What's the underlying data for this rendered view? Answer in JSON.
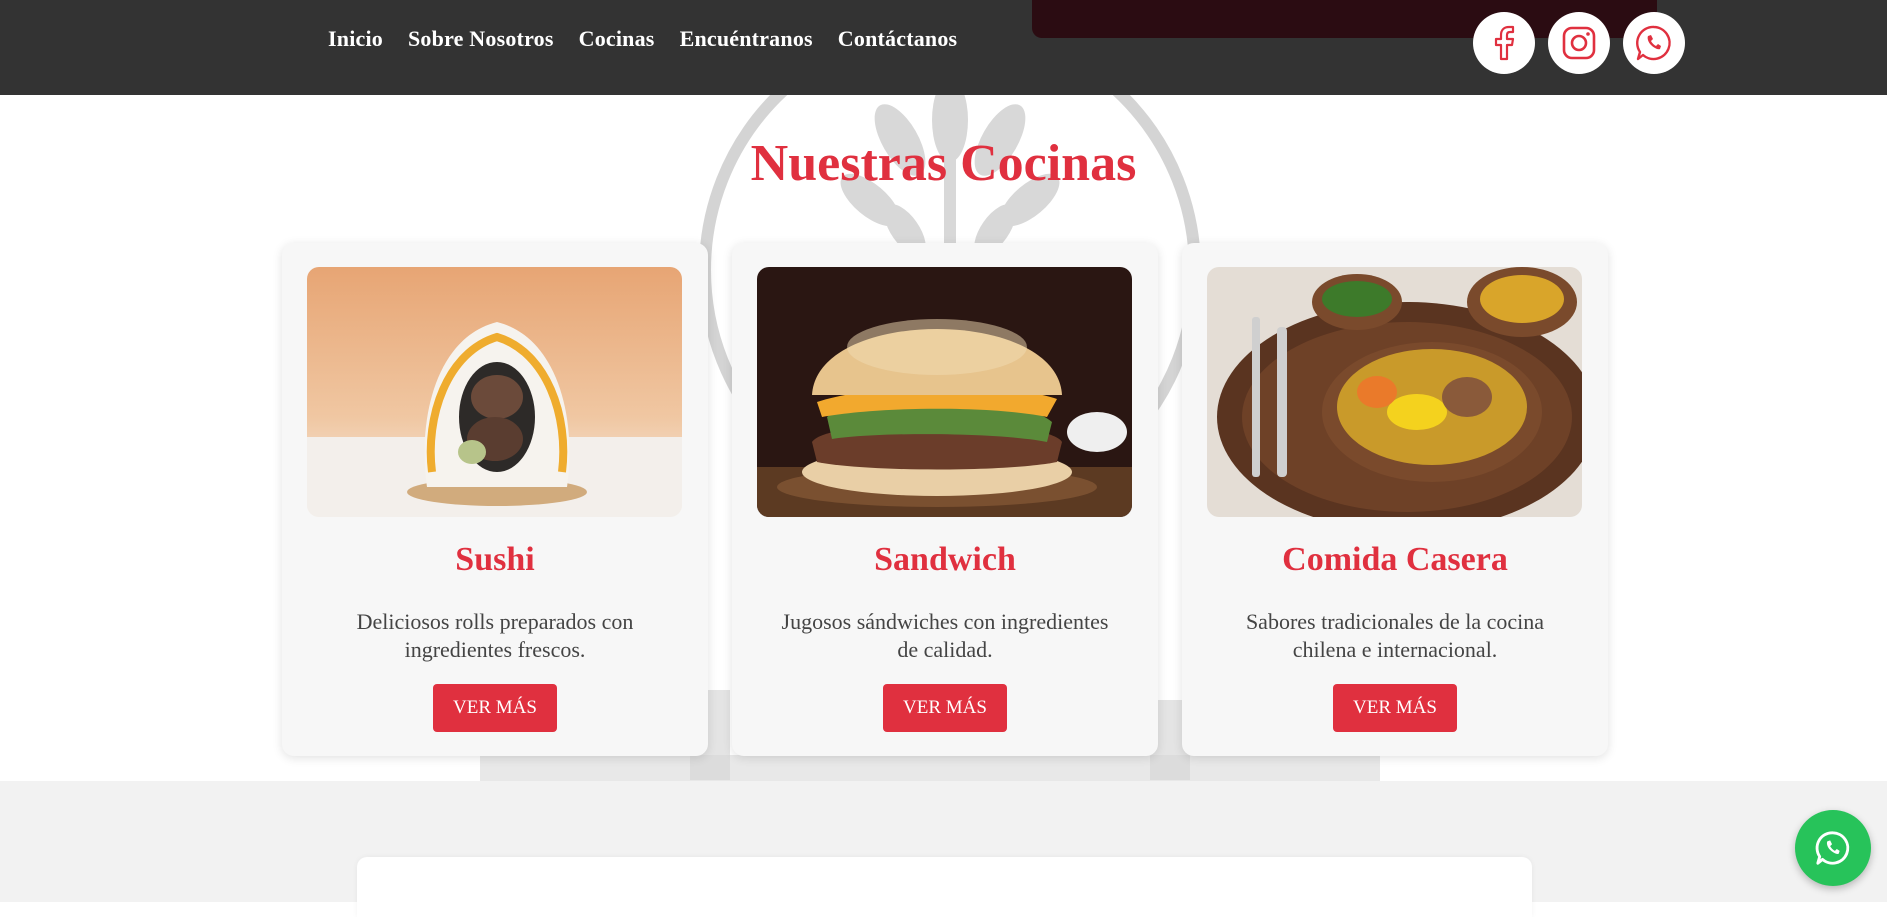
{
  "nav": {
    "items": [
      {
        "label": "Inicio"
      },
      {
        "label": "Sobre Nosotros"
      },
      {
        "label": "Cocinas"
      },
      {
        "label": "Encuéntranos"
      },
      {
        "label": "Contáctanos"
      }
    ]
  },
  "socials": [
    {
      "icon": "facebook-icon"
    },
    {
      "icon": "instagram-icon"
    },
    {
      "icon": "whatsapp-icon"
    }
  ],
  "section": {
    "title": "Nuestras Cocinas",
    "cards": [
      {
        "title": "Sushi",
        "description": "Deliciosos rolls preparados con ingredientes frescos.",
        "button": "VER MÁS"
      },
      {
        "title": "Sandwich",
        "description": "Jugosos sándwiches con ingredientes de calidad.",
        "button": "VER MÁS"
      },
      {
        "title": "Comida Casera",
        "description": "Sabores tradicionales de la cocina chilena e internacional.",
        "button": "VER MÁS"
      }
    ]
  },
  "floating": {
    "icon": "whatsapp-icon"
  },
  "colors": {
    "header": "#333333",
    "accent": "#e0303f",
    "whatsapp": "#27c35a",
    "card_bg": "#f7f7f7",
    "lower_bg": "#f2f2f2"
  }
}
